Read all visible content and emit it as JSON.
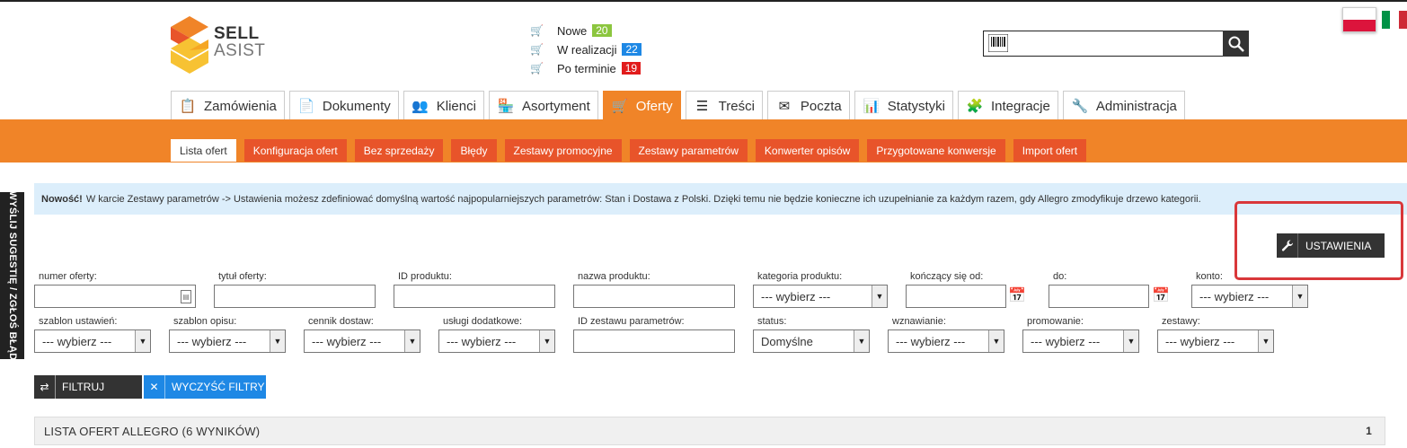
{
  "brand": {
    "line1": "SELL",
    "line2": "ASIST",
    "colors": {
      "orange": "#f08428",
      "yellow": "#f7c233",
      "red": "#e8542a"
    }
  },
  "orders": [
    {
      "label": "Nowe",
      "count": "20",
      "color": "#8cc63f"
    },
    {
      "label": "W realizacji",
      "count": "22",
      "color": "#1e88e5"
    },
    {
      "label": "Po terminie",
      "count": "19",
      "color": "#e11c1c"
    }
  ],
  "search": {
    "placeholder": "",
    "icon": "search-icon",
    "barcode_icon": "barcode-icon"
  },
  "flags": {
    "pl": "pl-flag",
    "it": "it-flag"
  },
  "main_tabs": [
    {
      "label": "Zamówienia",
      "icon": "clipboard-icon"
    },
    {
      "label": "Dokumenty",
      "icon": "document-icon"
    },
    {
      "label": "Klienci",
      "icon": "users-icon"
    },
    {
      "label": "Asortyment",
      "icon": "store-icon"
    },
    {
      "label": "Oferty",
      "icon": "cart-icon",
      "active": true
    },
    {
      "label": "Treści",
      "icon": "list-icon"
    },
    {
      "label": "Poczta",
      "icon": "mail-icon"
    },
    {
      "label": "Statystyki",
      "icon": "chart-icon"
    },
    {
      "label": "Integracje",
      "icon": "puzzle-icon"
    },
    {
      "label": "Administracja",
      "icon": "wrench-icon"
    }
  ],
  "sub_tabs": [
    {
      "label": "Lista ofert",
      "active": true
    },
    {
      "label": "Konfiguracja ofert"
    },
    {
      "label": "Bez sprzedaży"
    },
    {
      "label": "Błędy"
    },
    {
      "label": "Zestawy promocyjne"
    },
    {
      "label": "Zestawy parametrów"
    },
    {
      "label": "Konwerter opisów"
    },
    {
      "label": "Przygotowane konwersje"
    },
    {
      "label": "Import ofert"
    }
  ],
  "feedback_tab": "WYŚLIJ SUGESTIĘ / ZGŁOŚ BŁĄD",
  "info": {
    "strong": "Nowość!",
    "text": "W karcie Zestawy parametrów -> Ustawienia możesz zdefiniować domyślną wartość najpopularniejszych parametrów: Stan i Dostawa z Polski. Dzięki temu nie będzie konieczne ich uzupełnianie za każdym razem, gdy Allegro zmodyfikuje drzewo kategorii."
  },
  "settings_button": "USTAWIENIA",
  "filters": {
    "row1": {
      "offer_number": "numer oferty:",
      "offer_title": "tytuł oferty:",
      "product_id": "ID produktu:",
      "product_name": "nazwa produktu:",
      "category": "kategoria produktu:",
      "category_value": "--- wybierz ---",
      "ending_from": "kończący się od:",
      "to": "do:",
      "account": "konto:",
      "account_value": "--- wybierz ---"
    },
    "row2": {
      "settings_template": "szablon ustawień:",
      "settings_template_value": "--- wybierz ---",
      "description_template": "szablon opisu:",
      "description_template_value": "--- wybierz ---",
      "shipping_price_list": "cennik dostaw:",
      "shipping_price_list_value": "--- wybierz ---",
      "additional_services": "usługi dodatkowe:",
      "additional_services_value": "--- wybierz ---",
      "parameter_set_id": "ID zestawu parametrów:",
      "status": "status:",
      "status_value": "Domyślne",
      "renewal": "wznawianie:",
      "renewal_value": "--- wybierz ---",
      "promotion": "promowanie:",
      "promotion_value": "--- wybierz ---",
      "sets": "zestawy:",
      "sets_value": "--- wybierz ---"
    }
  },
  "buttons": {
    "filter": "FILTRUJ",
    "clear": "WYCZYŚĆ FILTRY"
  },
  "list": {
    "title": "LISTA OFERT ALLEGRO (6 WYNIKÓW)",
    "page": "1"
  }
}
